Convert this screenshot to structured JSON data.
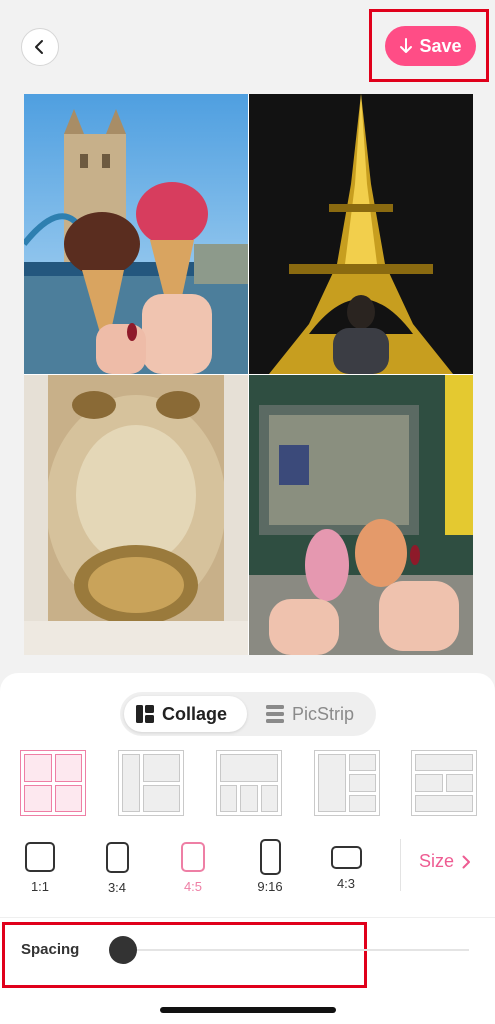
{
  "header": {
    "back_icon": "chevron-left-icon",
    "save_label": "Save",
    "save_icon": "arrow-down-icon",
    "accent": "#ff4d86"
  },
  "collage": {
    "photos": [
      {
        "subject": "ice cream cones in front of Tower Bridge",
        "icon": "photo-london"
      },
      {
        "subject": "Eiffel Tower lit at night",
        "icon": "photo-paris"
      },
      {
        "subject": "Versailles chapel painted ceiling",
        "icon": "photo-versailles"
      },
      {
        "subject": "macarons in front of a shop window",
        "icon": "photo-macarons"
      }
    ]
  },
  "modes": {
    "collage": {
      "label": "Collage",
      "icon": "grid-icon",
      "active": true
    },
    "picstrip": {
      "label": "PicStrip",
      "icon": "strip-icon",
      "active": false
    }
  },
  "layouts": {
    "selected_index": 0,
    "count": 5
  },
  "ratios": {
    "items": [
      {
        "label": "1:1"
      },
      {
        "label": "3:4"
      },
      {
        "label": "4:5"
      },
      {
        "label": "9:16"
      },
      {
        "label": "4:3"
      }
    ],
    "selected_index": 2
  },
  "size": {
    "label": "Size",
    "icon": "chevron-right-icon"
  },
  "spacing": {
    "label": "Spacing",
    "value": 0
  },
  "colors": {
    "pink": "#ee7fa5",
    "highlight": "#e0001b"
  }
}
